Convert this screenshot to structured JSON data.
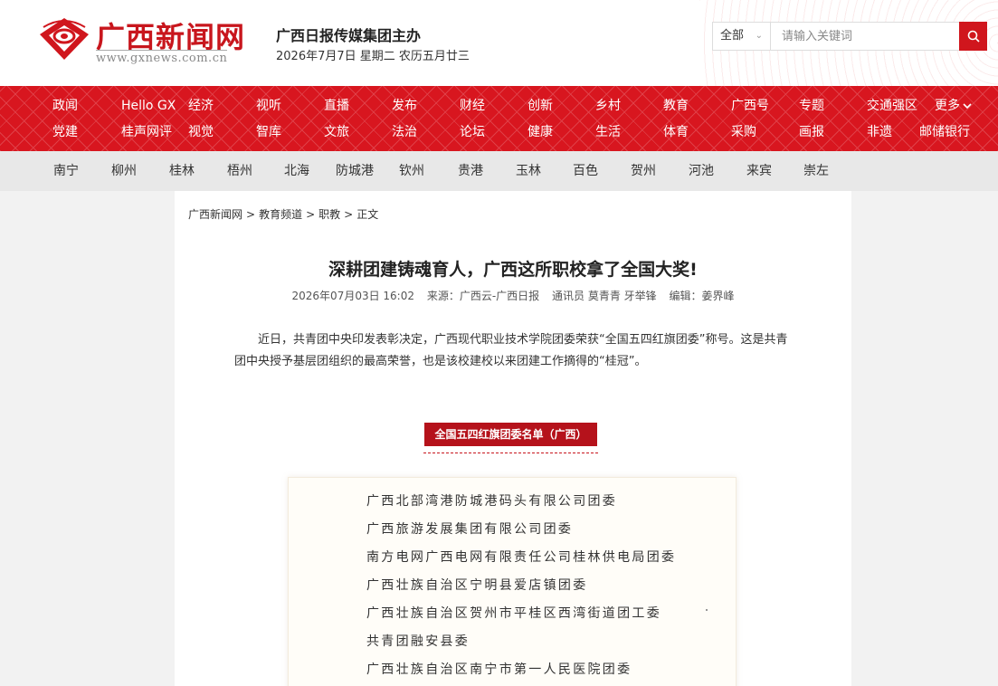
{
  "header": {
    "logo_text": "广西新闻网",
    "logo_url": "www.gxnews.com.cn",
    "org": "广西日报传媒集团主办",
    "date": "2026年7月7日 星期二 农历五月廿三"
  },
  "search": {
    "scope": "全部",
    "placeholder": "请输入关键词"
  },
  "nav": {
    "row1": [
      "政闻",
      "Hello GX",
      "经济",
      "视听",
      "直播",
      "发布",
      "财经",
      "创新",
      "乡村",
      "教育",
      "广西号",
      "专题",
      "交通强区",
      "更多"
    ],
    "row2": [
      "党建",
      "桂声网评",
      "视觉",
      "智库",
      "文旅",
      "法治",
      "论坛",
      "健康",
      "生活",
      "体育",
      "采购",
      "画报",
      "非遗",
      "邮储银行"
    ]
  },
  "cities": [
    "南宁",
    "柳州",
    "桂林",
    "梧州",
    "北海",
    "防城港",
    "钦州",
    "贵港",
    "玉林",
    "百色",
    "贺州",
    "河池",
    "来宾",
    "崇左"
  ],
  "article": {
    "breadcrumb": [
      "广西新闻网",
      "教育频道",
      "职教",
      "正文"
    ],
    "breadcrumb_sep": ">",
    "title": "深耕团建铸魂育人，广西这所职校拿了全国大奖!",
    "meta": {
      "time": "2026年07月03日 16:02",
      "source": "来源：广西云-广西日报",
      "reporter": "通讯员 莫青青 牙举锋",
      "editor": "编辑：姜界峰"
    },
    "paragraph": "近日，共青团中央印发表彰决定，广西现代职业技术学院团委荣获“全国五四红旗团委”称号。这是共青团中央授予基层团组织的最高荣誉，也是该校建校以来团建工作摘得的“桂冠”。",
    "badge": "全国五四红旗团委名单（广西）",
    "list": [
      "广西北部湾港防城港码头有限公司团委",
      "广西旅游发展集团有限公司团委",
      "南方电网广西电网有限责任公司桂林供电局团委",
      "广西壮族自治区宁明县爱店镇团委",
      "广西壮族自治区贺州市平桂区西湾街道团工委",
      "共青团融安县委",
      "广西壮族自治区南宁市第一人民医院团委"
    ]
  },
  "colors": {
    "brand_red": "#d8161f",
    "badge_red": "#b5121b"
  }
}
